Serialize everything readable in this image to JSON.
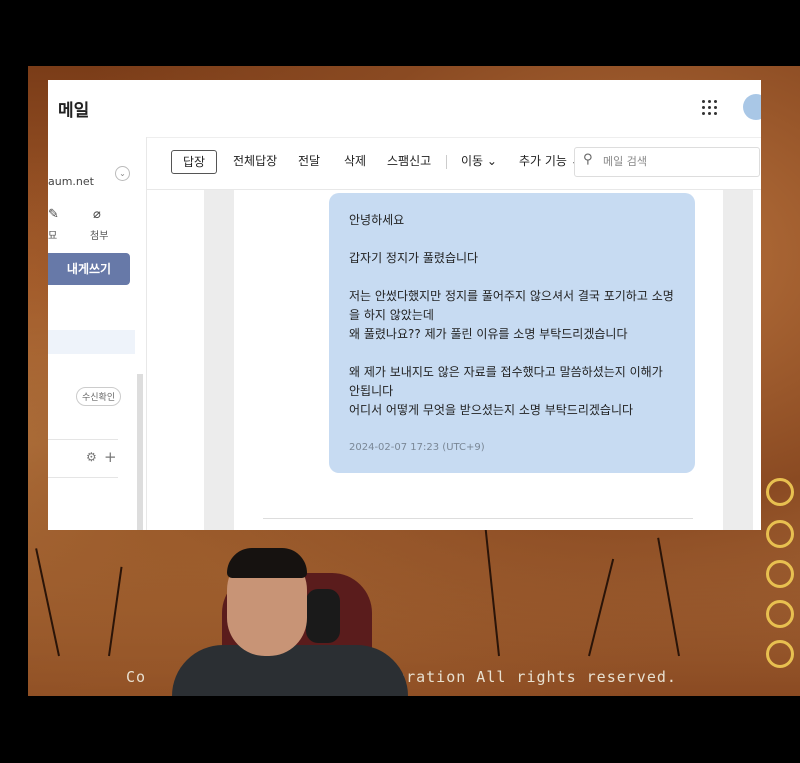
{
  "app": {
    "title": "메일"
  },
  "sidebar": {
    "account_partial": "aum.net",
    "attach_label": "첨부",
    "partial_label": "묘",
    "compose_label": "내게쓰기",
    "read_receipt_label": "수신확인"
  },
  "toolbar": {
    "reply": "답장",
    "reply_all": "전체답장",
    "forward": "전달",
    "delete": "삭제",
    "spam": "스팸신고",
    "move": "이동 ⌄",
    "more": "추가 기능 ⌄"
  },
  "search": {
    "placeholder": "메일 검색"
  },
  "message": {
    "body": "안녕하세요\n\n갑자기 정지가 풀렸습니다\n\n저는 안썼다했지만 정지를 풀어주지 않으셔서 결국 포기하고 소명을 하지 않았는데\n왜 풀렸나요?? 제가 풀린 이유를 소명 부탁드리겠습니다\n\n왜 제가 보내지도 않은 자료를 접수했다고 말씀하셨는지 이해가 안됩니다\n어디서 어떻게 무엇을 받으셨는지 소명 부탁드리겠습니다",
    "timestamp": "2024-02-07 17:23 (UTC+9)"
  },
  "game": {
    "copyright_left": "Co",
    "copyright_right": "oration  All  rights reserved."
  },
  "colors": {
    "bubble": "#c7dbf2",
    "compose_button": "#6779a8",
    "game_frame": "#a85e2c"
  }
}
